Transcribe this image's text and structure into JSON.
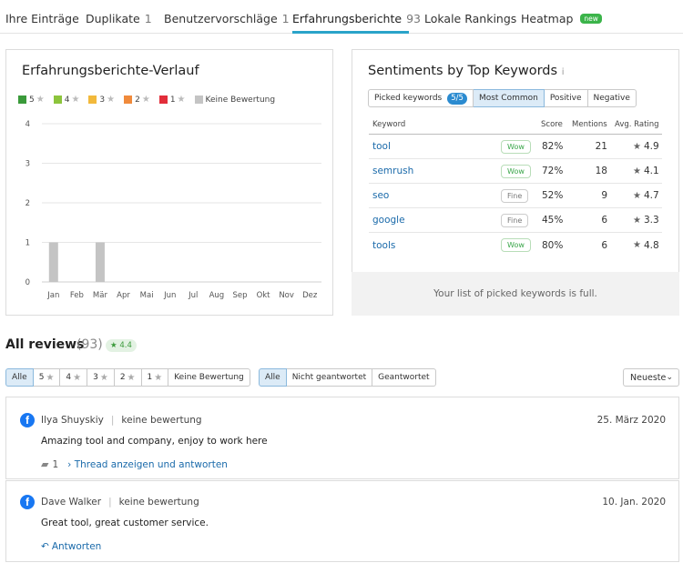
{
  "tabs": [
    {
      "label": "Ihre Einträge",
      "count": ""
    },
    {
      "label": "Duplikate",
      "count": "1"
    },
    {
      "label": "Benutzervorschläge",
      "count": "1"
    },
    {
      "label": "Erfahrungsberichte",
      "count": "93"
    },
    {
      "label": "Lokale Rankings",
      "count": ""
    },
    {
      "label": "Heatmap",
      "count": "",
      "badge": "new"
    }
  ],
  "active_tab": "Erfahrungsberichte",
  "history": {
    "title": "Erfahrungsberichte-Verlauf",
    "legend": [
      {
        "label": "5",
        "color": "#3a9a3a"
      },
      {
        "label": "4",
        "color": "#8cc43c"
      },
      {
        "label": "3",
        "color": "#f2b93b"
      },
      {
        "label": "2",
        "color": "#f08a3c"
      },
      {
        "label": "1",
        "color": "#e22e3a"
      },
      {
        "label": "Keine Bewertung",
        "color": "#c4c4c4"
      }
    ]
  },
  "chart_data": {
    "type": "bar",
    "categories": [
      "Jan",
      "Feb",
      "Mär",
      "Apr",
      "Mai",
      "Jun",
      "Jul",
      "Aug",
      "Sep",
      "Okt",
      "Nov",
      "Dez"
    ],
    "series": [
      {
        "name": "Keine Bewertung",
        "values": [
          1,
          0,
          1,
          0,
          0,
          0,
          0,
          0,
          0,
          0,
          0,
          0
        ]
      }
    ],
    "yticks": [
      "0",
      "1",
      "2",
      "3",
      "4"
    ],
    "ylim": [
      0,
      4
    ],
    "grid": true,
    "legend_position": "top-left"
  },
  "sentiments": {
    "title": "Sentiments by Top Keywords",
    "segments": [
      {
        "label": "Picked keywords",
        "pill": "5/5"
      },
      {
        "label": "Most Common",
        "selected": true
      },
      {
        "label": "Positive"
      },
      {
        "label": "Negative"
      }
    ],
    "headers": {
      "keyword": "Keyword",
      "score": "Score",
      "mentions": "Mentions",
      "rating": "Avg. Rating"
    },
    "rows": [
      {
        "keyword": "tool",
        "tag": "Wow",
        "score": "82%",
        "mentions": "21",
        "rating": "4.9"
      },
      {
        "keyword": "semrush",
        "tag": "Wow",
        "score": "72%",
        "mentions": "18",
        "rating": "4.1"
      },
      {
        "keyword": "seo",
        "tag": "Fine",
        "score": "52%",
        "mentions": "9",
        "rating": "4.7"
      },
      {
        "keyword": "google",
        "tag": "Fine",
        "score": "45%",
        "mentions": "6",
        "rating": "3.3"
      },
      {
        "keyword": "tools",
        "tag": "Wow",
        "score": "80%",
        "mentions": "6",
        "rating": "4.8"
      }
    ],
    "footer": "Your list of picked keywords is full."
  },
  "reviews": {
    "title": "All reviews",
    "count": "(93)",
    "rating": "4.4",
    "star_filters": [
      "Alle",
      "5",
      "4",
      "3",
      "2",
      "1",
      "Keine Bewertung"
    ],
    "reply_filters": [
      "Alle",
      "Nicht geantwortet",
      "Geantwortet"
    ],
    "sort": "Neueste",
    "items": [
      {
        "author": "Ilya Shuyskiy",
        "rating": "keine bewertung",
        "date": "25. März 2020",
        "text": "Amazing tool and company, enjoy to work here",
        "comments": "1",
        "action": "Thread anzeigen und antworten"
      },
      {
        "author": "Dave Walker",
        "rating": "keine bewertung",
        "date": "10. Jan. 2020",
        "text": "Great tool, great customer service.",
        "action": "Antworten"
      }
    ]
  },
  "colors": {
    "accent": "#2aa3c9",
    "link": "#1a6aaa",
    "bar": "#c4c4c4",
    "facebook": "#1877f2"
  }
}
